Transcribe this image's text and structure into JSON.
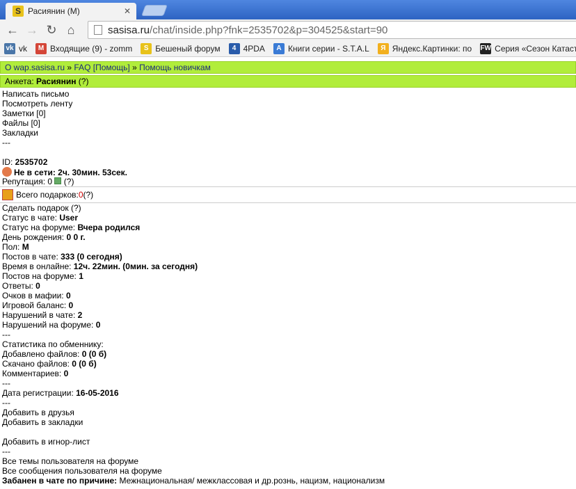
{
  "browser": {
    "tab_title": "Расиянин (М)",
    "tab_close": "✕",
    "url_host": "sasisa.ru",
    "url_path": "/chat/inside.php?fnk=2535702&p=304525&start=90",
    "bookmarks": [
      {
        "icon": "vk-icon",
        "label": "vk",
        "color": "#4a76a8",
        "glyph": "vk"
      },
      {
        "icon": "gmail-icon",
        "label": "Входящие (9) - zomm",
        "color": "#d44638",
        "glyph": "M"
      },
      {
        "icon": "sasisa-icon",
        "label": "Бешеный форум",
        "color": "#e8c21a",
        "glyph": "S"
      },
      {
        "icon": "4pda-icon",
        "label": "4PDA",
        "color": "#2a5caa",
        "glyph": "4"
      },
      {
        "icon": "android-icon",
        "label": "Книги серии - S.T.A.L",
        "color": "#3a7bd5",
        "glyph": "A"
      },
      {
        "icon": "yandex-images-icon",
        "label": "Яндекс.Картинки: по",
        "color": "#f2b01e",
        "glyph": "Я"
      },
      {
        "icon": "fw-icon",
        "label": "Серия «Сезон Катаст",
        "color": "#222222",
        "glyph": "FW"
      }
    ]
  },
  "nav": {
    "breadcrumb": [
      "O wap.sasisa.ru",
      "FAQ [Помощь]",
      "Помощь новичкам"
    ],
    "sep": " » ",
    "profile_label": "Анкета: ",
    "profile_name": "Расиянин",
    "profile_q": " (?)"
  },
  "links": {
    "write": "Написать письмо",
    "feed": "Посмотреть ленту",
    "notes": "Заметки [0]",
    "files": "Файлы [0]",
    "bookmarks": "Закладки",
    "sep": "---"
  },
  "profile": {
    "id_label": "ID: ",
    "id_value": "2535702",
    "offline": "Не в сети: 2ч. 30мин. 53сек.",
    "rep_label": "Репутация: 0 ",
    "rep_q": " (?)",
    "gifts_label": "Всего подарков: ",
    "gifts_value": "0",
    "gifts_q": " (?)",
    "make_gift": "Сделать подарок (?)",
    "chat_status_label": "Статус в чате: ",
    "chat_status": "User",
    "forum_status_label": "Статус на форуме: ",
    "forum_status": "Вчера родился",
    "birthday_label": "День рождения: ",
    "birthday": "0 0 г.",
    "sex_label": "Пол: ",
    "sex": "М",
    "chat_posts_label": "Постов в чате: ",
    "chat_posts": "333 (0 сегодня)",
    "online_label": "Время в онлайне: ",
    "online": "12ч. 22мин. (0мин. за сегодня)",
    "forum_posts_label": "Постов на форуме: ",
    "forum_posts": "1",
    "answers_label": "Ответы: ",
    "answers": "0",
    "mafia_label": "Очков в мафии: ",
    "mafia": "0",
    "game_label": "Игровой баланс: ",
    "game": "0",
    "chat_viol_label": "Нарушений в чате: ",
    "chat_viol": "2",
    "forum_viol_label": "Нарушений на форуме: ",
    "forum_viol": "0",
    "exchange_title": "Статистика по обменнику:",
    "added_label": "Добавлено файлов: ",
    "added": "0 (0 б)",
    "down_label": "Скачано файлов: ",
    "down": "0 (0 б)",
    "comments_label": "Комментариев: ",
    "comments": "0",
    "reg_label": "Дата регистрации: ",
    "reg": "16-05-2016"
  },
  "actions": {
    "add_friend": "Добавить в друзья",
    "add_bookmark": "Добавить в закладки",
    "ignore": "Добавить в игнор-лист",
    "all_topics": "Все темы пользователя на форуме",
    "all_posts": "Все сообщения пользователя на форуме",
    "ban_label": "Забанен в чате по причине: ",
    "ban_reason": "Межнациональная/ межклассовая и др.рознь, нацизм, национализм"
  }
}
